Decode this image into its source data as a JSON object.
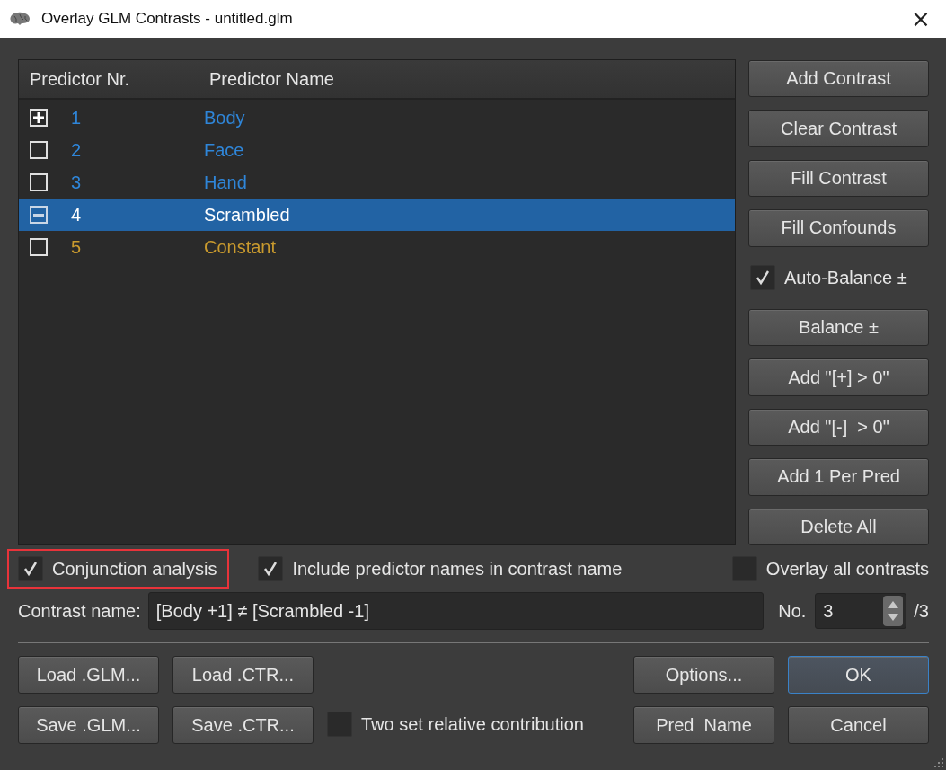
{
  "window": {
    "title": "Overlay GLM Contrasts - untitled.glm",
    "close": "×"
  },
  "table": {
    "columns": [
      "Predictor Nr.",
      "Predictor Name"
    ],
    "rows": [
      {
        "nr": "1",
        "name": "Body",
        "plus": true,
        "minus": false,
        "selected": false,
        "color": "#2f86d9"
      },
      {
        "nr": "2",
        "name": "Face",
        "plus": false,
        "minus": false,
        "selected": false,
        "color": "#2f86d9"
      },
      {
        "nr": "3",
        "name": "Hand",
        "plus": false,
        "minus": false,
        "selected": false,
        "color": "#2f86d9"
      },
      {
        "nr": "4",
        "name": "Scrambled",
        "plus": false,
        "minus": true,
        "selected": true
      },
      {
        "nr": "5",
        "name": "Constant",
        "plus": false,
        "minus": false,
        "selected": false,
        "color": "#c99a2e"
      }
    ]
  },
  "actions": [
    {
      "kind": "button",
      "label": "Add Contrast"
    },
    {
      "kind": "button",
      "label": "Clear Contrast"
    },
    {
      "kind": "button",
      "label": "Fill Contrast"
    },
    {
      "kind": "button",
      "label": "Fill Confounds"
    },
    {
      "kind": "checkbox",
      "label": "Auto-Balance ±",
      "checked": true
    },
    {
      "kind": "button",
      "label": "Balance ±"
    },
    {
      "kind": "button",
      "label": "Add \"[+] > 0\""
    },
    {
      "kind": "button",
      "label": "Add \"[-]  > 0\""
    },
    {
      "kind": "button",
      "label": "Add 1 Per Pred"
    },
    {
      "kind": "button",
      "label": "Delete All"
    }
  ],
  "options": [
    {
      "label": "Conjunction analysis",
      "checked": true,
      "highlighted": true
    },
    {
      "label": "Include predictor names in contrast name",
      "checked": true,
      "highlighted": false
    },
    {
      "label": "Overlay all contrasts",
      "checked": false,
      "highlighted": false
    }
  ],
  "contrast": {
    "label": "Contrast name:",
    "value": "[Body +1] ≠ [Scrambled -1]",
    "no_label": "No.",
    "no_value": "3",
    "total": "/3"
  },
  "file_buttons": [
    {
      "label": "Load .GLM..."
    },
    {
      "label": "Load .CTR..."
    },
    {
      "label": "Save .GLM..."
    },
    {
      "label": "Save .CTR..."
    }
  ],
  "two_set": {
    "label": "Two set relative contribution",
    "checked": false
  },
  "dialog_buttons": [
    {
      "label": "Options...",
      "default": false
    },
    {
      "label": "OK",
      "default": true
    },
    {
      "label": "Pred  Name",
      "default": false
    },
    {
      "label": "Cancel",
      "default": false
    }
  ]
}
